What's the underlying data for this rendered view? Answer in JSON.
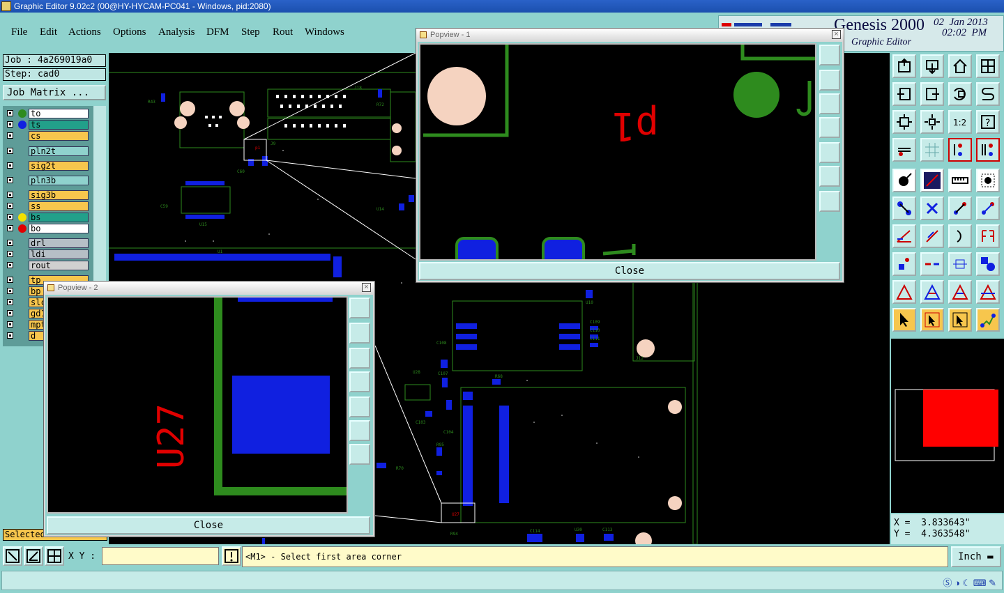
{
  "window": {
    "title": "Graphic Editor 9.02c2 (00@HY-HYCAM-PC041 - Windows, pid:2080)"
  },
  "menu": [
    "File",
    "Edit",
    "Actions",
    "Options",
    "Analysis",
    "DFM",
    "Step",
    "Rout",
    "Windows"
  ],
  "header": {
    "product": "Genesis 2000",
    "subtitle": "Graphic Editor",
    "date": "02  Jan 2013",
    "time": "02:02  PM"
  },
  "job": {
    "job_label": "Job : 4a269019a0",
    "step_label": "Step: cad0",
    "matrix_button": "Job Matrix ..."
  },
  "layers": [
    {
      "name": "to",
      "color": "#ffffff",
      "dot": "#2e8b1e"
    },
    {
      "name": "ts",
      "color": "#22a08a",
      "dot": "#1020e0"
    },
    {
      "name": "cs",
      "color": "#f7c64d",
      "dot": ""
    },
    {
      "name": "pln2t",
      "color": "#8fd2cd",
      "dot": ""
    },
    {
      "name": "sig2t",
      "color": "#f7c64d",
      "dot": ""
    },
    {
      "name": "pln3b",
      "color": "#8fd2cd",
      "dot": ""
    },
    {
      "name": "sig3b",
      "color": "#f7c64d",
      "dot": ""
    },
    {
      "name": "ss",
      "color": "#f7c64d",
      "dot": ""
    },
    {
      "name": "bs",
      "color": "#22a08a",
      "dot": "#f2e000"
    },
    {
      "name": "bo",
      "color": "#ffffff",
      "dot": "#e00000"
    },
    {
      "name": "drl",
      "color": "#b6bfc6",
      "dot": ""
    },
    {
      "name": "ldi",
      "color": "#b6bfc6",
      "dot": ""
    },
    {
      "name": "rout",
      "color": "#d0d0d0",
      "dot": ""
    },
    {
      "name": "tp",
      "color": "#f7c64d",
      "dot": ""
    },
    {
      "name": "bp",
      "color": "#f7c64d",
      "dot": ""
    },
    {
      "name": "slc",
      "color": "#f7c64d",
      "dot": ""
    },
    {
      "name": "gd1",
      "color": "#f7c64d",
      "dot": ""
    },
    {
      "name": "mpt",
      "color": "#f7c64d",
      "dot": ""
    },
    {
      "name": "d",
      "color": "#f7c64d",
      "dot": ""
    }
  ],
  "status": {
    "selected": "Selected",
    "xy_label": "X Y :",
    "xy_value": "",
    "prompt": "<M1> - Select first area corner",
    "unit": "Inch"
  },
  "coords": {
    "x": "X =  3.833643\"",
    "y": "Y =  4.363548\""
  },
  "popview1": {
    "title": "Popview - 1",
    "close": "Close",
    "label": "p1"
  },
  "popview2": {
    "title": "Popview - 2",
    "close": "Close",
    "label": "U27"
  },
  "board_labels": {
    "l1": "J18",
    "l2": "R72",
    "l3": "R43",
    "l4": "U15",
    "l5": "C59",
    "l6": "U1",
    "l7": "U14",
    "l8": "U28",
    "l9": "C108",
    "l10": "C107",
    "l11": "R68",
    "l12": "C103",
    "l13": "C104",
    "l14": "R95",
    "l15": "R70",
    "l16": "C114",
    "l17": "U30",
    "l18": "C113",
    "l19": "R94",
    "l20": "J12",
    "l21": "C109",
    "l22": "C110",
    "l23": "C111",
    "l24": "U10",
    "l25": "U27",
    "l26": "J9",
    "l27": "C60"
  },
  "colors": {
    "app_bg": "#8fd2cd",
    "board_outline": "#2e8b1e",
    "pad": "#1020e0",
    "silk": "#e00000",
    "hole": "#f5d3c0"
  }
}
